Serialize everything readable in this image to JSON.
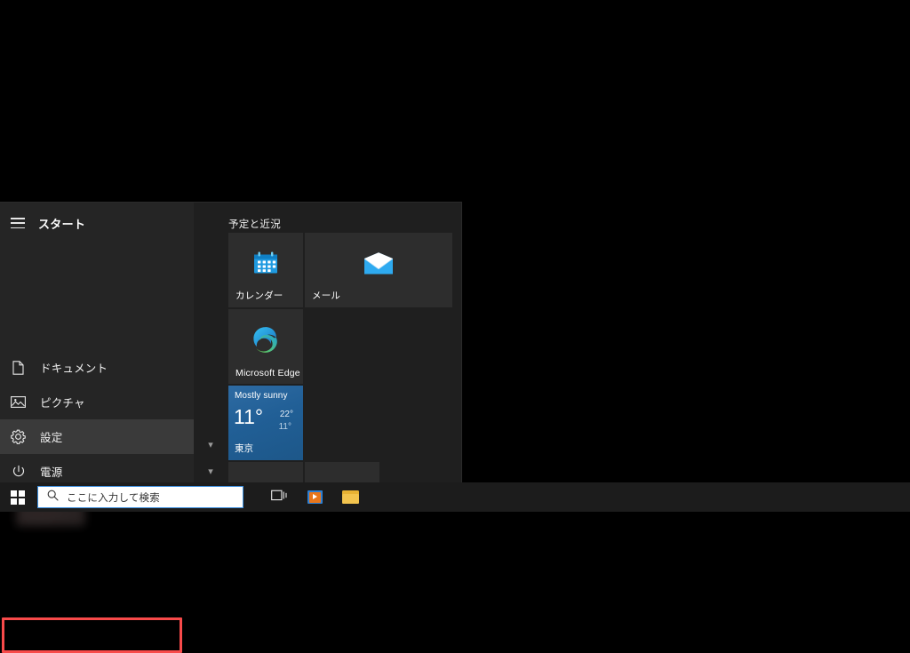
{
  "desktop": {
    "background_color": "#000000"
  },
  "start_menu": {
    "rail": {
      "menu_icon": "hamburger-icon",
      "title": "スタート",
      "account_placeholder": "",
      "items": [
        {
          "icon": "document-icon",
          "label": "ドキュメント",
          "selected": false
        },
        {
          "icon": "picture-icon",
          "label": "ピクチャ",
          "selected": false
        },
        {
          "icon": "gear-icon",
          "label": "設定",
          "selected": true
        },
        {
          "icon": "power-icon",
          "label": "電源",
          "selected": false
        }
      ]
    },
    "tiles": {
      "group_title": "予定と近況",
      "items": [
        {
          "id": "calendar",
          "label": "カレンダー",
          "icon": "calendar-icon",
          "size": "medium"
        },
        {
          "id": "mail",
          "label": "メール",
          "icon": "mail-envelope-icon",
          "size": "wide"
        },
        {
          "id": "edge",
          "label": "Microsoft Edge",
          "icon": "edge-logo-icon",
          "size": "medium"
        }
      ],
      "weather": {
        "condition": "Mostly sunny",
        "temperature": "11°",
        "high": "22°",
        "low": "11°",
        "location": "東京",
        "accent_color": "#21639b"
      },
      "scroll_chevrons": [
        "chevron-down-icon",
        "chevron-down-icon"
      ]
    }
  },
  "annotation": {
    "type": "highlight-rectangle",
    "color": "#f84a4a",
    "target": "設定"
  },
  "taskbar": {
    "start_button": "windows-logo-icon",
    "search": {
      "icon": "search-icon",
      "placeholder": "ここに入力して検索",
      "value": ""
    },
    "buttons": [
      {
        "id": "task-view",
        "icon": "task-view-icon"
      },
      {
        "id": "media-player",
        "icon": "media-player-icon"
      },
      {
        "id": "file-explorer",
        "icon": "folder-icon"
      }
    ]
  }
}
